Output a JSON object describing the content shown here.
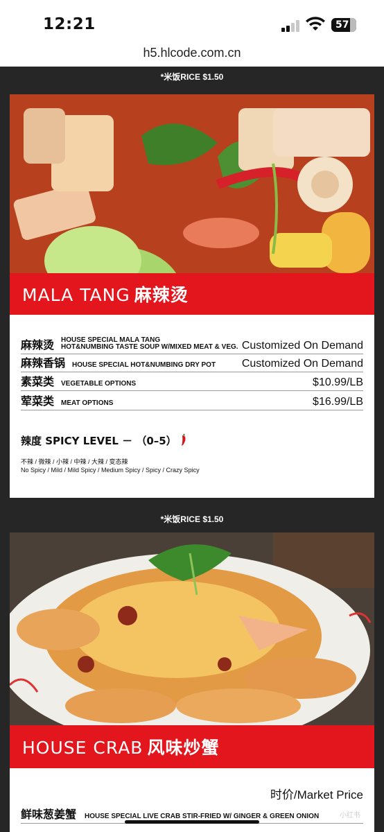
{
  "status_bar": {
    "time": "12:21",
    "battery": "57"
  },
  "browser": {
    "url": "h5.hlcode.com.cn"
  },
  "colors": {
    "accent_red": "#e3151d",
    "background_dark": "#262626"
  },
  "sections": [
    {
      "rice_note": "*米饭RICE $1.50",
      "banner_en": "MALA TANG",
      "banner_cn": "麻辣烫",
      "items": [
        {
          "cn": "麻辣烫",
          "en_line1": "HOUSE SPECIAL MALA TANG",
          "en_line2": "HOT&NUMBING TASTE SOUP W/MIXED MEAT & VEG.",
          "price": "Customized On Demand"
        },
        {
          "cn": "麻辣香锅",
          "en_line1": "HOUSE SPECIAL HOT&NUMBING DRY POT",
          "en_line2": "",
          "price": "Customized On Demand"
        },
        {
          "cn": "素菜类",
          "en_line1": "VEGETABLE OPTIONS",
          "en_line2": "",
          "price": "$10.99/LB"
        },
        {
          "cn": "荤菜类",
          "en_line1": "MEAT OPTIONS",
          "en_line2": "",
          "price": "$16.99/LB"
        }
      ],
      "spicy": {
        "title": "辣度 SPICY LEVEL － （0–5）",
        "levels_cn": "不辣 / 微辣 / 小辣 / 中辣 / 大辣 / 变态辣",
        "levels_en": "No Spicy /  Mild / Mild Spicy / Medium Spicy / Spicy / Crazy Spicy"
      }
    },
    {
      "rice_note": "*米饭RICE $1.50",
      "banner_en": "HOUSE CRAB",
      "banner_cn": "风味炒蟹",
      "market_price": "时价/Market  Price",
      "items": [
        {
          "cn": "鲜味葱姜蟹",
          "en_line1": "HOUSE SPECIAL  LIVE CRAB STIR-FRIED W/ GINGER & GREEN ONION",
          "en_line2": "",
          "price": ""
        }
      ]
    }
  ],
  "watermark": "小红书"
}
